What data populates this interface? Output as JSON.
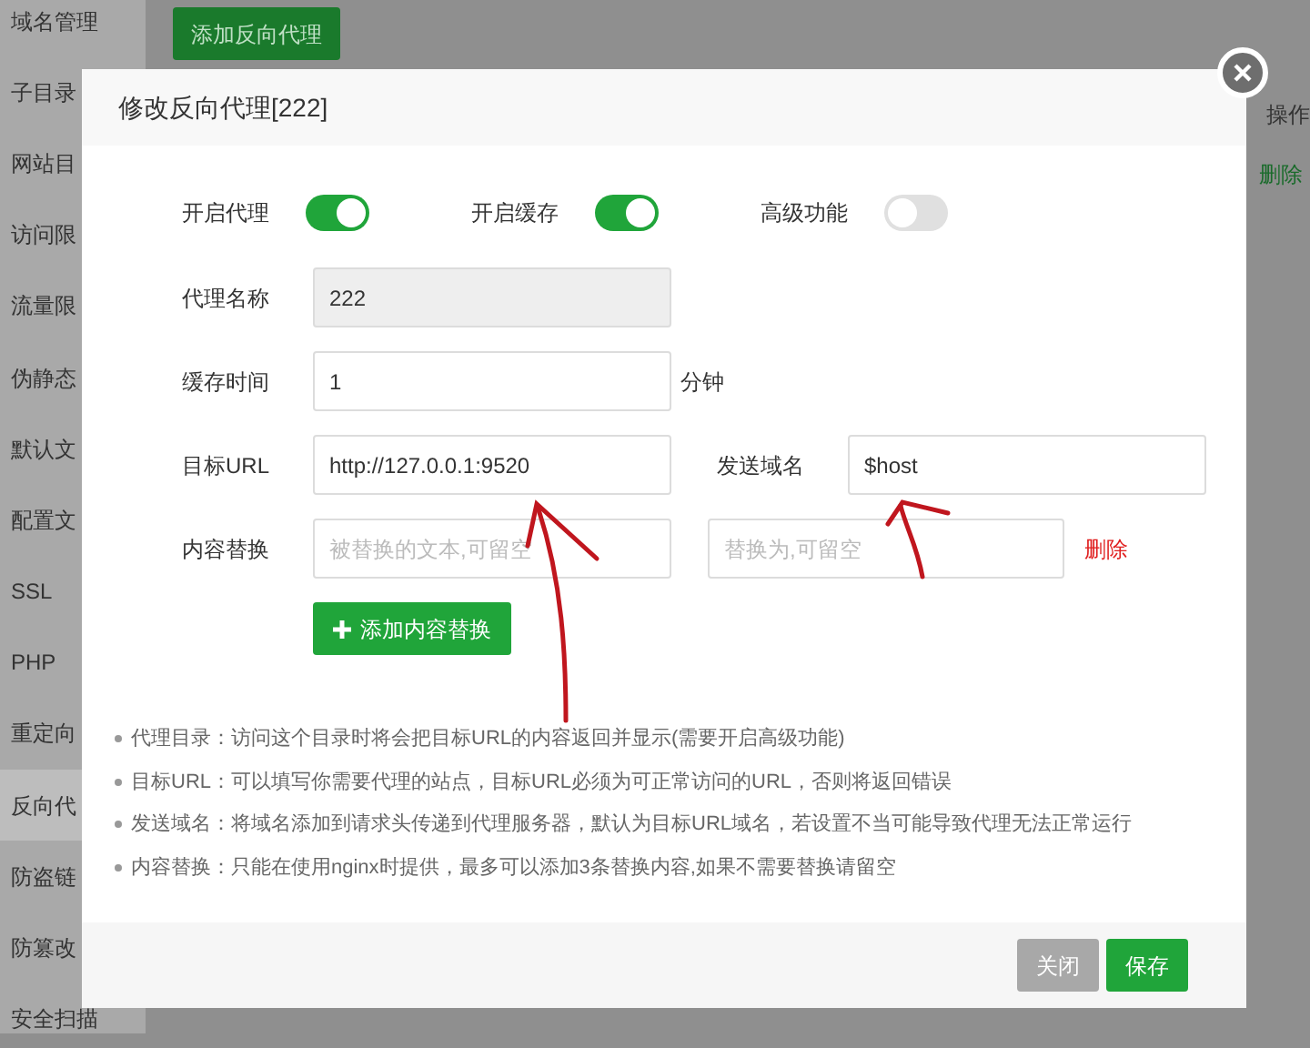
{
  "sidebar": {
    "items": [
      {
        "label": "域名管理",
        "selected": false
      },
      {
        "label": "子目录",
        "selected": false
      },
      {
        "label": "网站目",
        "selected": false
      },
      {
        "label": "访问限",
        "selected": false
      },
      {
        "label": "流量限",
        "selected": false
      },
      {
        "label": "伪静态",
        "selected": false
      },
      {
        "label": "默认文",
        "selected": false
      },
      {
        "label": "配置文",
        "selected": false
      },
      {
        "label": "SSL",
        "selected": false
      },
      {
        "label": "PHP",
        "selected": false
      },
      {
        "label": "重定向",
        "selected": false
      },
      {
        "label": "反向代",
        "selected": true
      },
      {
        "label": "防盗链",
        "selected": false
      },
      {
        "label": "防篡改",
        "selected": false
      },
      {
        "label": "安全扫描",
        "selected": false
      }
    ]
  },
  "background": {
    "add_button": "添加反向代理",
    "column_header": "操作",
    "row_action": "删除"
  },
  "dialog": {
    "title": "修改反向代理[222]",
    "toggles": [
      {
        "label": "开启代理",
        "on": true
      },
      {
        "label": "开启缓存",
        "on": true
      },
      {
        "label": "高级功能",
        "on": false
      }
    ],
    "fields": [
      {
        "label": "代理名称",
        "value": "222",
        "disabled": true
      },
      {
        "label": "缓存时间",
        "value": "1",
        "disabled": false,
        "suffix": "分钟"
      }
    ],
    "target_url": {
      "label": "目标URL",
      "value": "http://127.0.0.1:9520"
    },
    "send_domain": {
      "label": "发送域名",
      "value": "$host"
    },
    "replace": {
      "label": "内容替换",
      "from_placeholder": "被替换的文本,可留空",
      "to_placeholder": "替换为,可留空",
      "delete": "删除"
    },
    "add_replace_button": "添加内容替换",
    "notes": [
      "代理目录：访问这个目录时将会把目标URL的内容返回并显示(需要开启高级功能)",
      "目标URL：可以填写你需要代理的站点，目标URL必须为可正常访问的URL，否则将返回错误",
      "发送域名：将域名添加到请求头传递到代理服务器，默认为目标URL域名，若设置不当可能导致代理无法正常运行",
      "内容替换：只能在使用nginx时提供，最多可以添加3条替换内容,如果不需要替换请留空"
    ],
    "buttons": [
      {
        "label": "关闭",
        "kind": "secondary"
      },
      {
        "label": "保存",
        "kind": "primary"
      }
    ]
  }
}
